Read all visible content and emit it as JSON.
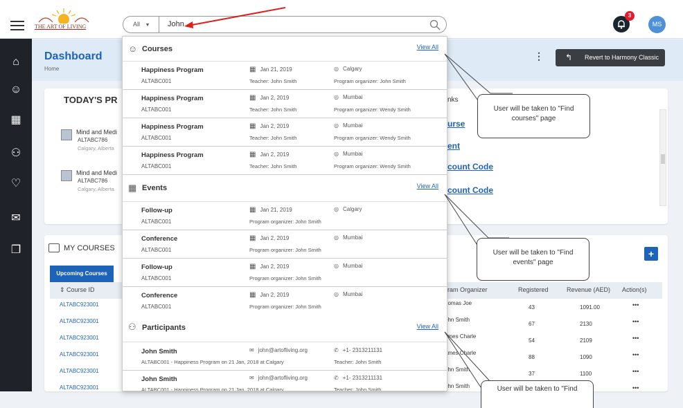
{
  "header": {
    "logo_text": "THE ART OF LIVING",
    "search": {
      "scope": "All",
      "value": "John"
    },
    "notification_count": "3",
    "avatar_initials": "MS"
  },
  "page": {
    "title": "Dashboard",
    "breadcrumb": "Home",
    "revert_label": "Revert to Harmony Classic",
    "more": "⋮"
  },
  "today": {
    "title": "TODAY'S PR",
    "items": [
      {
        "name": "Mind and Medi",
        "code": "ALTABC786",
        "loc": "Calgary, Alberta"
      },
      {
        "name": "Mind and Medi",
        "code": "ALTABC786",
        "loc": "Calgary, Alberta"
      }
    ]
  },
  "quick_links": {
    "title": "nks",
    "items": [
      "urse",
      "ent",
      "count Code",
      "count Code"
    ]
  },
  "my_courses": {
    "title": "MY COURSES",
    "tab": "Upcoming Courses",
    "add": "+",
    "columns": [
      "Course ID",
      "ram Organizer",
      "Registered",
      "Revenue (AED)",
      "Action(s)"
    ],
    "rows": [
      {
        "id": "ALTABC923001",
        "org": "homas Joe",
        "reg": "43",
        "rev": "1091.00",
        "act": "•••"
      },
      {
        "id": "ALTABC923001",
        "org": "ohn Smith",
        "reg": "67",
        "rev": "2130",
        "act": "•••"
      },
      {
        "id": "ALTABC923001",
        "org": "ames Charle",
        "reg": "54",
        "rev": "2109",
        "act": "•••"
      },
      {
        "id": "ALTABC923001",
        "org": "ames Charle",
        "reg": "88",
        "rev": "1090",
        "act": "•••"
      },
      {
        "id": "ALTABC923001",
        "org": "ohn Smith",
        "reg": "37",
        "rev": "1100",
        "act": "•••"
      },
      {
        "id": "ALTABC923001",
        "org": "ohn Smith",
        "reg": "",
        "rev": "",
        "act": "•••"
      }
    ]
  },
  "dropdown": {
    "courses": {
      "title": "Courses",
      "view_all": "View All",
      "items": [
        {
          "name": "Happiness Program",
          "code": "ALTABC001",
          "date": "Jan 21, 2019",
          "teacher": "Teacher: John Smith",
          "loc": "Calgary",
          "org": "Program organizer: John Smith"
        },
        {
          "name": "Happiness Program",
          "code": "ALTABC001",
          "date": "Jan 2, 2019",
          "teacher": "Teacher: John Smith",
          "loc": "Mumbai",
          "org": "Program organizer: Wendy Smith"
        },
        {
          "name": "Happiness Program",
          "code": "ALTABC001",
          "date": "Jan 2, 2019",
          "teacher": "Teacher: John Smith",
          "loc": "Mumbai",
          "org": "Program organizer: Wendy Smith"
        },
        {
          "name": "Happiness Program",
          "code": "ALTABC001",
          "date": "Jan 2, 2019",
          "teacher": "Teacher: John Smith",
          "loc": "Mumbai",
          "org": "Program organizer: Wendy Smith"
        }
      ]
    },
    "events": {
      "title": "Events",
      "view_all": "View All",
      "items": [
        {
          "name": "Follow-up",
          "code": "ALTABC001",
          "date": "Jan 21, 2019",
          "loc": "Calgary",
          "org": "Program organizer: John Smith"
        },
        {
          "name": "Conference",
          "code": "ALTABC001",
          "date": "Jan 2, 2019",
          "loc": "Mumbai",
          "org": "Program organizer: John Smith"
        },
        {
          "name": "Follow-up",
          "code": "ALTABC001",
          "date": "Jan 2, 2019",
          "loc": "Mumbai",
          "org": "Program organizer: John Smith"
        },
        {
          "name": "Conference",
          "code": "ALTABC001",
          "date": "Jan 2, 2019",
          "loc": "Mumbai",
          "org": "Program organizer: John Smith"
        }
      ]
    },
    "participants": {
      "title": "Participants",
      "view_all": "View All",
      "items": [
        {
          "name": "John Smith",
          "detail": "ALTABC001 - Happiness Program on 21 Jan, 2018 at Calgary",
          "email": "john@artofliving.org",
          "phone": "+1- 2313211131",
          "teacher": "Teacher: John Smith"
        },
        {
          "name": "John Smith",
          "detail": "ALTABC001 - Happiness Program on 21 Jan, 2018 at Calgary",
          "email": "john@artofliving.org",
          "phone": "+1- 2313211131",
          "teacher": "Teacher: John Smith"
        }
      ]
    }
  },
  "callouts": {
    "courses": "User will be taken to \"Find courses\" page",
    "events": "User will be taken to \"Find events\" page",
    "participants": "User will be taken to \"Find"
  },
  "colors": {
    "accent": "#1d63b8",
    "sidebar": "#1f2329",
    "annotation_arrow": "#e0201f"
  }
}
